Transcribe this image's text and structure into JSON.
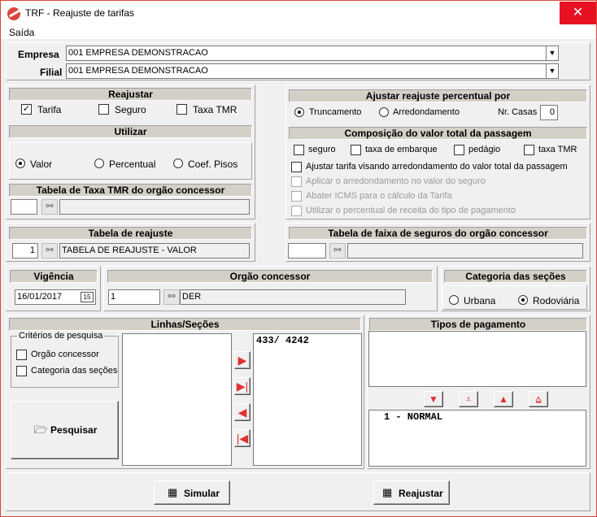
{
  "window": {
    "title": "TRF - Reajuste de tarifas",
    "close": "✕"
  },
  "menu": {
    "saida": "Saída"
  },
  "empresa": {
    "label": "Empresa",
    "value": "001 EMPRESA DEMONSTRACAO"
  },
  "filial": {
    "label": "Filial",
    "value": "001 EMPRESA DEMONSTRACAO"
  },
  "reajustar": {
    "title": "Reajustar",
    "tarifa": "Tarifa",
    "seguro": "Seguro",
    "taxa": "Taxa TMR"
  },
  "utilizar": {
    "title": "Utilizar",
    "valor": "Valor",
    "percentual": "Percentual",
    "coef": "Coef. Pisos"
  },
  "tabela_tmr": {
    "title": "Tabela de Taxa TMR do orgão concessor",
    "code": "",
    "desc": ""
  },
  "ajustar": {
    "title": "Ajustar reajuste percentual por",
    "truncamento": "Truncamento",
    "arredondamento": "Arredondamento",
    "nr_casas_label": "Nr. Casas",
    "nr_casas": "0"
  },
  "composicao": {
    "title": "Composição do valor total da passagem",
    "seguro": "seguro",
    "taxa_embarque": "taxa de embarque",
    "pedagio": "pedágio",
    "taxa_tmr": "taxa TMR"
  },
  "opcoes": {
    "ajustar": "Ajustar tarifa visando arredondamento do valor total da passagem",
    "aplicar": "Aplicar o arredondamento no valor do seguro",
    "abater": "Abater ICMS para o cálculo da Tarifa",
    "utilizar": "Utilizar o percentual de receita do tipo de pagamento"
  },
  "tabela_reajuste": {
    "title": "Tabela de reajuste",
    "code": "1",
    "desc": "TABELA DE REAJUSTE - VALOR"
  },
  "tabela_seguros": {
    "title": "Tabela de faixa de seguros do orgão concessor",
    "code": "",
    "desc": ""
  },
  "vigencia": {
    "title": "Vigência",
    "date": "16/01/2017",
    "cal": "15"
  },
  "orgao": {
    "title": "Orgão concessor",
    "code": "1",
    "desc": "DER"
  },
  "categoria": {
    "title": "Categoria das seções",
    "urbana": "Urbana",
    "rodoviaria": "Rodoviária"
  },
  "linhas": {
    "title": "Linhas/Seções",
    "criterios": "Critérios de pesquisa",
    "orgao": "Orgão concessor",
    "categoria": "Categoria das seções",
    "pesquisar": "Pesquisar",
    "selected": [
      "433/ 4242"
    ]
  },
  "tipos": {
    "title": "Tipos de pagamento",
    "items": [
      "1 - NORMAL"
    ]
  },
  "actions": {
    "simular": "Simular",
    "reajustar": "Reajustar"
  }
}
